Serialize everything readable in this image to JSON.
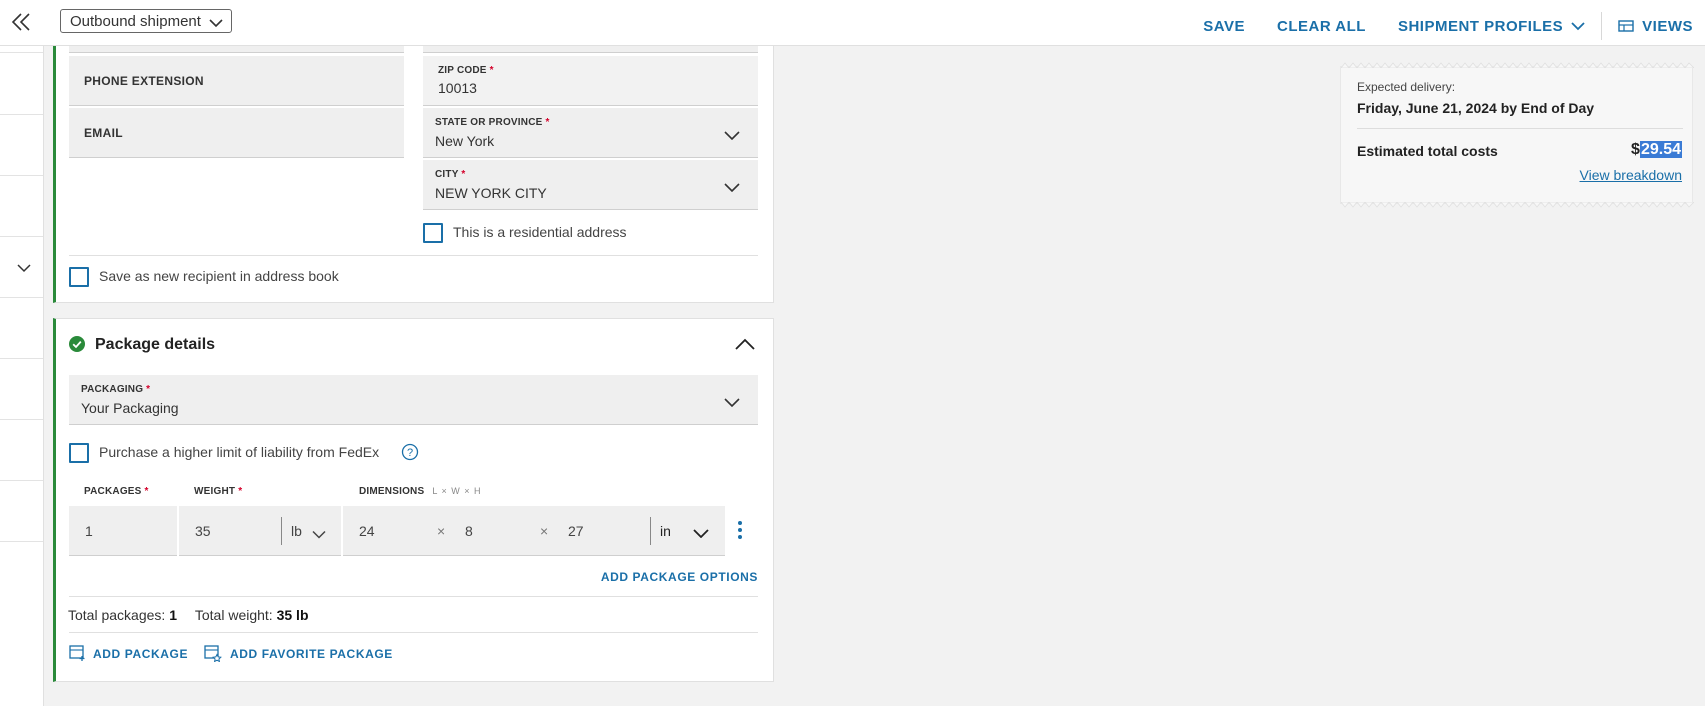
{
  "topbar": {
    "shipment_type": "Outbound shipment",
    "save": "SAVE",
    "clear_all": "CLEAR ALL",
    "shipment_profiles": "SHIPMENT PROFILES",
    "views": "VIEWS"
  },
  "recipient": {
    "phone_extension_label": "PHONE EXTENSION",
    "email_label": "EMAIL",
    "zip": {
      "label": "ZIP CODE",
      "value": "10013"
    },
    "state": {
      "label": "STATE OR PROVINCE",
      "value": "New York"
    },
    "city": {
      "label": "CITY",
      "value": "NEW YORK CITY"
    },
    "residential_label": "This is a residential address",
    "save_recipient_label": "Save as new recipient in address book"
  },
  "package": {
    "title": "Package details",
    "packaging": {
      "label": "PACKAGING",
      "value": "Your Packaging"
    },
    "liability_label": "Purchase a higher limit of liability from FedEx",
    "packages_label": "PACKAGES",
    "weight_label": "WEIGHT",
    "dimensions_label": "DIMENSIONS",
    "dimensions_hint": "L × W × H",
    "packages_value": "1",
    "weight_value": "35",
    "weight_unit": "lb",
    "length": "24",
    "width": "8",
    "height": "27",
    "dim_unit": "in",
    "times_symbol": "×",
    "add_package_options": "ADD PACKAGE OPTIONS",
    "total_packages_label": "Total packages:",
    "total_packages_value": "1",
    "total_weight_label": "Total weight:",
    "total_weight_value": "35 lb",
    "add_package": "ADD PACKAGE",
    "add_favorite_package": "ADD FAVORITE PACKAGE"
  },
  "summary": {
    "expected_label": "Expected delivery:",
    "expected_date": "Friday, June 21, 2024 by End of Day",
    "cost_label": "Estimated total costs",
    "currency": "$",
    "cost_value": "29.54",
    "view_breakdown": "View breakdown"
  },
  "colors": {
    "accent_blue": "#1a6fa8",
    "success_green": "#2a8a3a",
    "required_red": "#d4002a"
  }
}
